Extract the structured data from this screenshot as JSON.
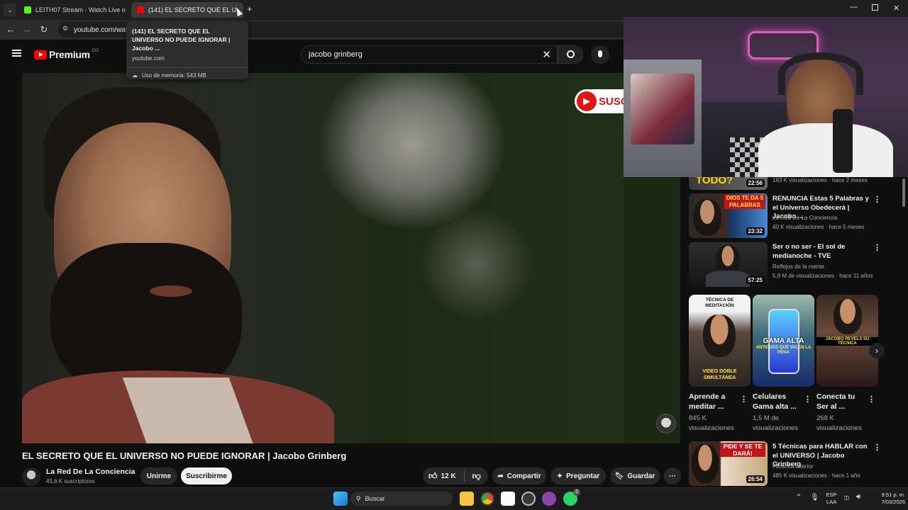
{
  "browser": {
    "tabs": [
      {
        "label": "LEITH07 Stream - Watch Live o",
        "active": false
      },
      {
        "label": "(141) EL SECRETO QUE EL U",
        "active": true
      }
    ],
    "new_tab": "+",
    "url": "youtube.com/wat",
    "tooltip": {
      "title": "(141) EL SECRETO QUE EL UNIVERSO NO PUEDE IGNORAR | Jacobo ...",
      "domain": "youtube.com",
      "memory": "Uso de memoria: 543 MB"
    }
  },
  "youtube": {
    "logo_text": "Premium",
    "region": "CO",
    "search_value": "jacobo grinberg",
    "video": {
      "overlay_text": "SUSC",
      "title": "EL SECRETO QUE EL UNIVERSO NO PUEDE IGNORAR | Jacobo Grinberg",
      "channel": "La Red De La Conciencia",
      "subscribers": "45,6 K suscriptores",
      "join_label": "Unirme",
      "subscribe_label": "Suscribirme",
      "likes": "12 K",
      "share_label": "Compartir",
      "ask_label": "Preguntar",
      "save_label": "Guardar"
    },
    "sidebar": {
      "partial_top": {
        "thumb_text": "TODO?",
        "duration": "22:56",
        "meta": "193 K visualizaciones · hace 2 meses"
      },
      "videos": [
        {
          "title": "RENUNCIA Estas 5 Palabras y el Universo Obedecerá | Jacobo ...",
          "channel": "La Red De La Conciencia",
          "meta": "40 K visualizaciones · hace 5 meses",
          "duration": "23:32",
          "thumb_text": "DIOS TE DA 5 PALABRAS"
        },
        {
          "title": "Ser o no ser - El sol de medianoche - TVE",
          "channel": "Reflejos de la mente",
          "meta": "5,9 M de visualizaciones · hace 11 años",
          "duration": "57:25"
        },
        {
          "title": "5 Técnicas para HABLAR con el UNIVERSO | Jacobo Grinberg",
          "channel": "Filosofía Interior",
          "meta": "485 K visualizaciones · hace 1 año",
          "duration": "26:54",
          "thumb_text": "PIDE Y SE TE DARÁ!"
        }
      ],
      "shorts": [
        {
          "title": "Aprende a meditar ...",
          "views": "845 K visualizaciones",
          "top_text": "TÉCNICA DE MEDITACIÓN",
          "bottom_text": "VIDEO DOBLE SIMULTÁNEA"
        },
        {
          "title": "Celulares Gama alta ...",
          "views": "1,5 M de visualizaciones",
          "top_text": "GAMA ALTA",
          "sub_text": "ANTIGUOS QUE VALEN LA PENA"
        },
        {
          "title": "Conecta tu Ser al ...",
          "views": "268 K visualizaciones",
          "top_text": "JACOBO REVELA SU TÉCNICA"
        }
      ]
    }
  },
  "taskbar": {
    "search_label": "Buscar",
    "lang": "ESP",
    "lang2": "LAA",
    "time": "9:51 p. m.",
    "date": "7/03/2026",
    "whatsapp_badge": "2"
  },
  "colors": {
    "accent_red": "#e01515",
    "bg": "#0f0f0f",
    "pill": "#272727"
  }
}
